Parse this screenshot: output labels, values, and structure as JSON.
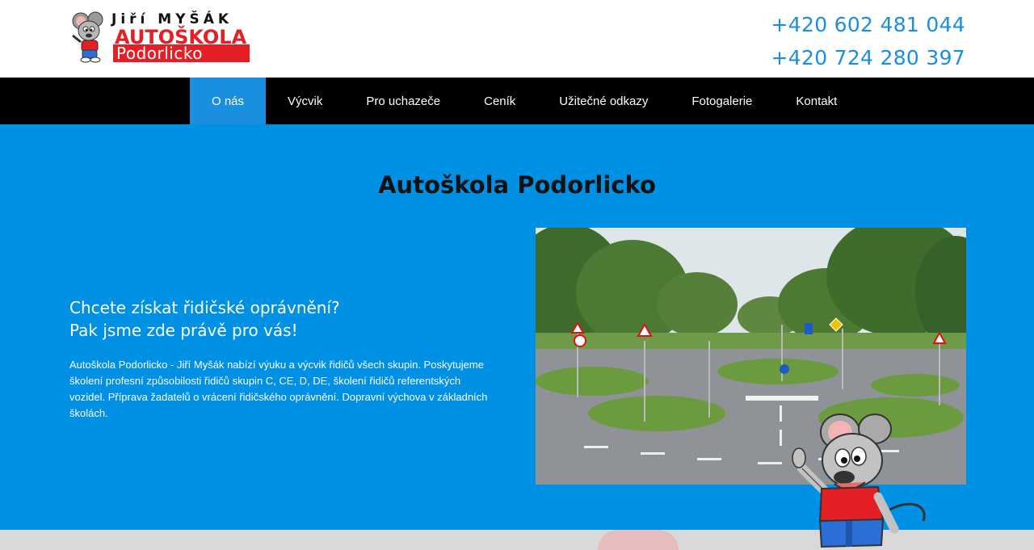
{
  "header": {
    "logo": {
      "top_line": "Jiří MYŠÁK",
      "main_line": "AUTOŠKOLA",
      "sub_line": "Podorlicko"
    },
    "phones": [
      "+420 602 481 044",
      "+420 724 280 397"
    ]
  },
  "nav": {
    "items": [
      {
        "label": "O nás",
        "active": true
      },
      {
        "label": "Výcvik"
      },
      {
        "label": "Pro uchazeče"
      },
      {
        "label": "Ceník"
      },
      {
        "label": "Užitečné odkazy"
      },
      {
        "label": "Fotogalerie"
      },
      {
        "label": "Kontakt"
      }
    ]
  },
  "hero": {
    "title": "Autoškola Podorlicko",
    "headline_line1": "Chcete získat řidičské oprávnění?",
    "headline_line2": "Pak jsme zde právě pro vás!",
    "body": "Autoškola Podorlicko - Jiří Myšák nabízí výuku a výcvik řidičů všech skupin. Poskytujeme školení profesní způsobilosti řidičů skupin C, CE, D, DE, školení řidičů referentských vozidel. Příprava žadatelů o vrácení řidičského oprávnění. Dopravní výchova v základních školách."
  },
  "colors": {
    "accent": "#1a8fe0",
    "hero_bg": "#0090e4",
    "nav_bg": "#000000",
    "logo_red": "#e41f26"
  }
}
